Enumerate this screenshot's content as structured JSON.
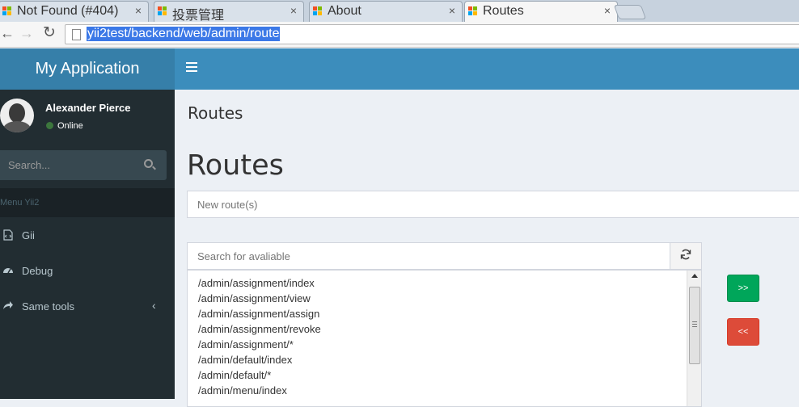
{
  "browser": {
    "tabs": [
      {
        "label": "Not Found (#404)",
        "active": false
      },
      {
        "label": "投票管理",
        "active": false
      },
      {
        "label": "About",
        "active": false
      },
      {
        "label": "Routes",
        "active": true
      }
    ],
    "close_glyph": "×",
    "url": "yii2test/backend/web/admin/route"
  },
  "header": {
    "app_name": "My Application"
  },
  "sidebar": {
    "user_name": "Alexander Pierce",
    "user_status": "Online",
    "search_placeholder": "Search...",
    "menu_header": "Menu Yii2",
    "items": [
      {
        "label": "Gii",
        "icon": "file-code-icon"
      },
      {
        "label": "Debug",
        "icon": "dashboard-icon"
      },
      {
        "label": "Same tools",
        "icon": "share-icon"
      }
    ],
    "chevron": "‹"
  },
  "content": {
    "page_title": "Routes",
    "heading": "Routes",
    "new_route_placeholder": "New route(s)",
    "search_placeholder": "Search for avaliable",
    "routes": [
      "/admin/assignment/index",
      "/admin/assignment/view",
      "/admin/assignment/assign",
      "/admin/assignment/revoke",
      "/admin/assignment/*",
      "/admin/default/index",
      "/admin/default/*",
      "/admin/menu/index"
    ],
    "assign_label": ">>",
    "remove_label": "<<"
  },
  "colors": {
    "header_dark": "#367fa9",
    "header": "#3c8dbc",
    "sidebar": "#222d32",
    "success": "#00a65a",
    "danger": "#dd4b39"
  }
}
